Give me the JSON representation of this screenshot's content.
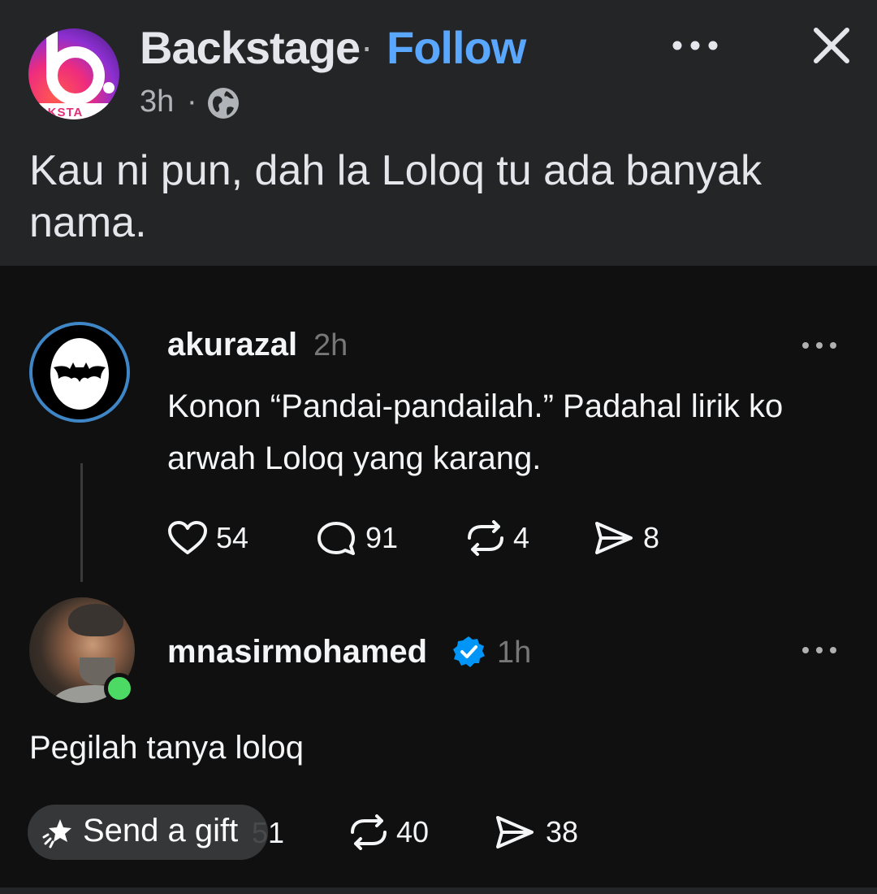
{
  "post": {
    "page_name": "Backstage",
    "separator": "·",
    "follow_label": "Follow",
    "time": "3h",
    "time_separator": "·",
    "avatar_text": "ACKSTA",
    "caption": "Kau ni pun, dah la Loloq tu ada banyak nama."
  },
  "threads": {
    "reply1": {
      "username": "akurazal",
      "time": "2h",
      "text": "Konon “Pandai-pandailah.” Padahal lirik ko arwah Loloq yang karang.",
      "likes": "54",
      "comments": "91",
      "reposts": "4",
      "shares": "8"
    },
    "reply2": {
      "username": "mnasirmohamed",
      "time": "1h",
      "text": "Pegilah tanya loloq",
      "comments_partial": "51",
      "reposts": "40",
      "shares": "38"
    }
  },
  "overlay": {
    "gift_label": "Send a gift"
  },
  "colors": {
    "background": "#242526",
    "threads_background": "#101010",
    "follow": "#5aa7ff",
    "verified": "#0095f6",
    "online": "#4cd964"
  }
}
